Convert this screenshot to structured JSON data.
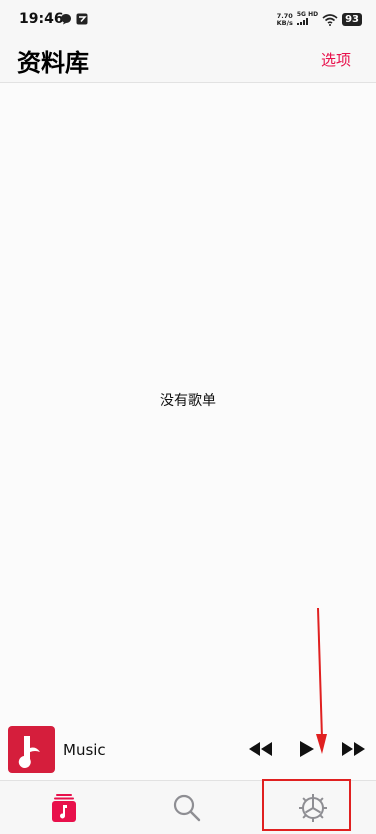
{
  "status_bar": {
    "time": "19:46",
    "net_speed_value": "7.70",
    "net_speed_unit": "KB/s",
    "network": "5G HD",
    "battery": "93",
    "icons": [
      "chat-bubble-icon",
      "notification-app-icon",
      "signal-icon",
      "wifi-icon",
      "battery-icon"
    ]
  },
  "header": {
    "title": "资料库",
    "options_label": "选项"
  },
  "main": {
    "empty_message": "没有歌单"
  },
  "mini_player": {
    "track_title": "Music",
    "icons": [
      "album-art-music-note-icon",
      "rewind-icon",
      "play-icon",
      "fast-forward-icon"
    ]
  },
  "tab_bar": {
    "tabs": [
      {
        "name": "library",
        "icon": "library-icon",
        "active": true
      },
      {
        "name": "search",
        "icon": "search-icon",
        "active": false
      },
      {
        "name": "settings",
        "icon": "settings-icon",
        "active": false
      }
    ]
  },
  "colors": {
    "accent": "#e8104b",
    "album_art": "#d51e3c",
    "annotation": "#e02020"
  }
}
